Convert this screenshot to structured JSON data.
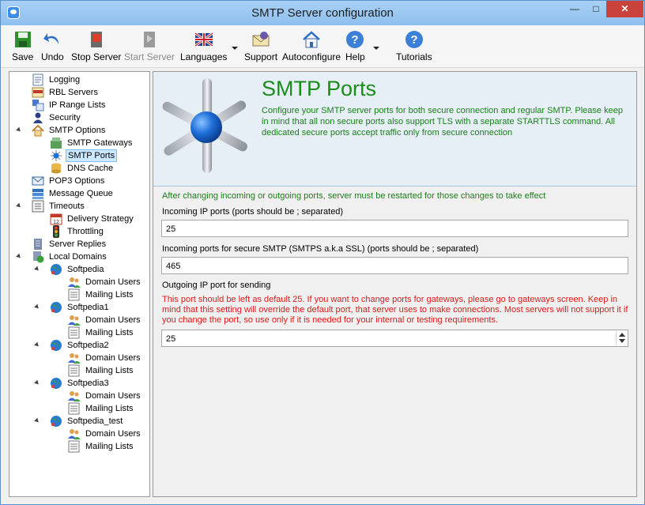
{
  "window": {
    "title": "SMTP Server configuration"
  },
  "toolbar": {
    "items": [
      {
        "label": "Save",
        "icon": "save-icon"
      },
      {
        "label": "Undo",
        "icon": "undo-icon"
      },
      {
        "label": "Stop Server",
        "icon": "stop-server-icon"
      },
      {
        "label": "Start Server",
        "icon": "start-server-icon",
        "disabled": true
      },
      {
        "label": "Languages",
        "icon": "uk-flag-icon"
      },
      {
        "label": "Support",
        "icon": "support-envelope-icon"
      },
      {
        "label": "Autoconfigure",
        "icon": "house-icon"
      },
      {
        "label": "Help",
        "icon": "help-icon"
      },
      {
        "label": "Tutorials",
        "icon": "tutorials-icon"
      }
    ]
  },
  "tree": {
    "items": [
      {
        "label": "Logging"
      },
      {
        "label": "RBL Servers"
      },
      {
        "label": "IP Range Lists"
      },
      {
        "label": "Security"
      },
      {
        "label": "SMTP Options"
      },
      {
        "label": "SMTP Gateways"
      },
      {
        "label": "SMTP Ports",
        "selected": true
      },
      {
        "label": "DNS Cache"
      },
      {
        "label": "POP3 Options"
      },
      {
        "label": "Message Queue"
      },
      {
        "label": "Timeouts"
      },
      {
        "label": "Delivery Strategy"
      },
      {
        "label": "Throttling"
      },
      {
        "label": "Server Replies"
      },
      {
        "label": "Local Domains"
      },
      {
        "label": "Softpedia"
      },
      {
        "label": "Domain Users"
      },
      {
        "label": "Mailing Lists"
      },
      {
        "label": "Softpedia1"
      },
      {
        "label": "Domain Users"
      },
      {
        "label": "Mailing Lists"
      },
      {
        "label": "Softpedia2"
      },
      {
        "label": "Domain Users"
      },
      {
        "label": "Mailing Lists"
      },
      {
        "label": "Softpedia3"
      },
      {
        "label": "Domain Users"
      },
      {
        "label": "Mailing Lists"
      },
      {
        "label": "Softpedia_test"
      },
      {
        "label": "Domain Users"
      },
      {
        "label": "Mailing Lists"
      }
    ]
  },
  "main": {
    "heading": "SMTP Ports",
    "description": "Configure your SMTP server ports for both secure connection and regular SMTP. Please keep in mind that all non secure ports also support TLS with a separate STARTTLS command. All dedicated secure ports accept traffic only from secure connection",
    "restart_note": "After changing incoming or outgoing ports, server must be restarted for those changes to take effect",
    "incoming_label": "Incoming IP ports (ports should be ; separated)",
    "incoming_value": "25",
    "secure_label": "Incoming ports for secure SMTP (SMTPS a.k.a SSL) (ports should be ; separated)",
    "secure_value": "465",
    "outgoing_label": "Outgoing IP port for sending",
    "outgoing_warning": "This port should be left as default 25. If you want to change ports for gateways, please go to gateways screen. Keep in mind that this setting will override the default port, that server uses to make connections. Most servers will not support it if you change the port, so use only if it is needed for your internal or testing requirements.",
    "outgoing_value": "25"
  },
  "colors": {
    "heading": "#1a8c1a",
    "warning": "#e01919",
    "selection": "#cce8ff"
  }
}
